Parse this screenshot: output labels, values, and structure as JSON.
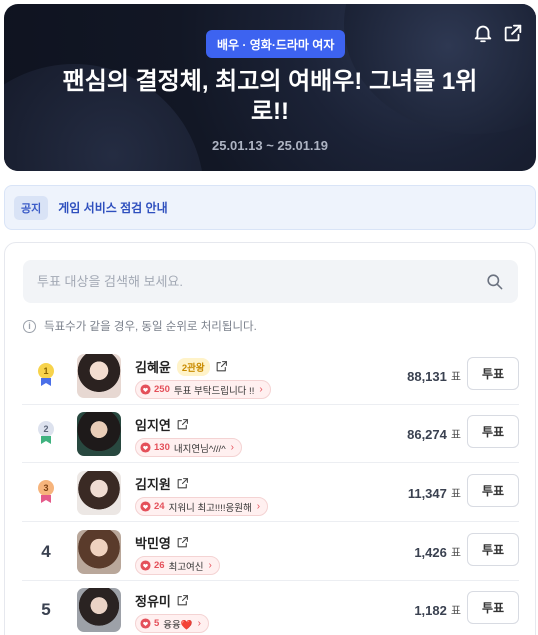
{
  "hero": {
    "category_badge": "배우 · 영화·드라마 여자",
    "title": "팬심의 결정체, 최고의 여배우! 그녀를 1위로!!",
    "date_range": "25.01.13 ~ 25.01.19",
    "icons": [
      "bell-icon",
      "share-icon"
    ]
  },
  "notice": {
    "tag": "공지",
    "text": "게임 서비스 점검 안내"
  },
  "search": {
    "placeholder": "투표 대상을 검색해 보세요."
  },
  "info_text": "득표수가 같을 경우, 동일 순위로 처리됩니다.",
  "vote_unit": "표",
  "vote_button_label": "투표",
  "colors": {
    "accent": "#3d63f0",
    "heart": "#e4505a",
    "gold": "#f1c232",
    "silver": "#c9cfe0",
    "bronze": "#f0a56b"
  },
  "rankings": [
    {
      "rank": "1",
      "medal": "gold",
      "name": "김혜윤",
      "badge": "2관왕",
      "cheer_count": "250",
      "cheer_text": "투표 부탁드립니다 !!",
      "votes": "88,131"
    },
    {
      "rank": "2",
      "medal": "silver",
      "name": "임지연",
      "badge": "",
      "cheer_count": "130",
      "cheer_text": "내지연님^///^",
      "votes": "86,274"
    },
    {
      "rank": "3",
      "medal": "bronze",
      "name": "김지원",
      "badge": "",
      "cheer_count": "24",
      "cheer_text": "지워니 최고!!!!응원해",
      "votes": "11,347"
    },
    {
      "rank": "4",
      "medal": "",
      "name": "박민영",
      "badge": "",
      "cheer_count": "26",
      "cheer_text": "최고여신",
      "votes": "1,426"
    },
    {
      "rank": "5",
      "medal": "",
      "name": "정유미",
      "badge": "",
      "cheer_count": "5",
      "cheer_text": "융융❤️",
      "votes": "1,182"
    }
  ]
}
